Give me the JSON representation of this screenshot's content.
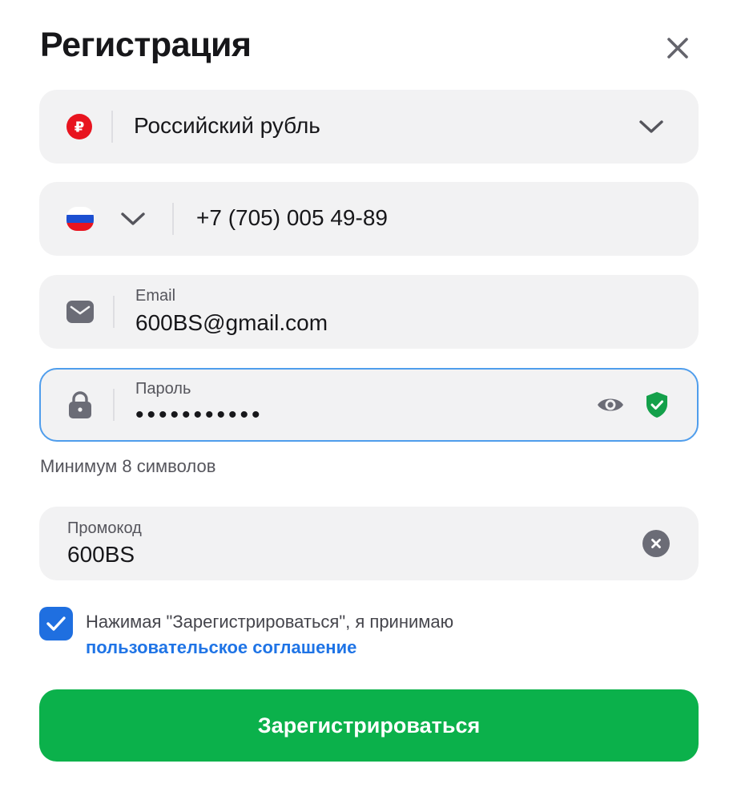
{
  "modal": {
    "title": "Регистрация",
    "close_icon": "close-icon"
  },
  "currency": {
    "icon": "ruble-icon",
    "value": "Российский рубль",
    "dropdown_icon": "chevron-down-icon"
  },
  "phone": {
    "flag_icon": "russia-flag-icon",
    "dropdown_icon": "chevron-down-icon",
    "value": "+7 (705) 005 49-89"
  },
  "email": {
    "icon": "envelope-icon",
    "label": "Email",
    "value": "600BS@gmail.com"
  },
  "password": {
    "icon": "lock-icon",
    "label": "Пароль",
    "value": "•••••••••••",
    "show_icon": "eye-icon",
    "strength_icon": "shield-check-icon",
    "hint": "Минимум 8 символов"
  },
  "promo": {
    "label": "Промокод",
    "value": "600BS",
    "clear_icon": "clear-icon"
  },
  "agreement": {
    "checked": true,
    "text": "Нажимая \"Зарегистрироваться\", я принимаю",
    "link": "пользовательское соглашение"
  },
  "submit": {
    "label": "Зарегистрироваться"
  },
  "colors": {
    "accent_blue": "#1f6fe0",
    "link_blue": "#1f74e6",
    "submit_green": "#0bb14b",
    "field_bg": "#f2f2f3",
    "ruble_red": "#e8141f",
    "shield_green": "#14a04a"
  }
}
